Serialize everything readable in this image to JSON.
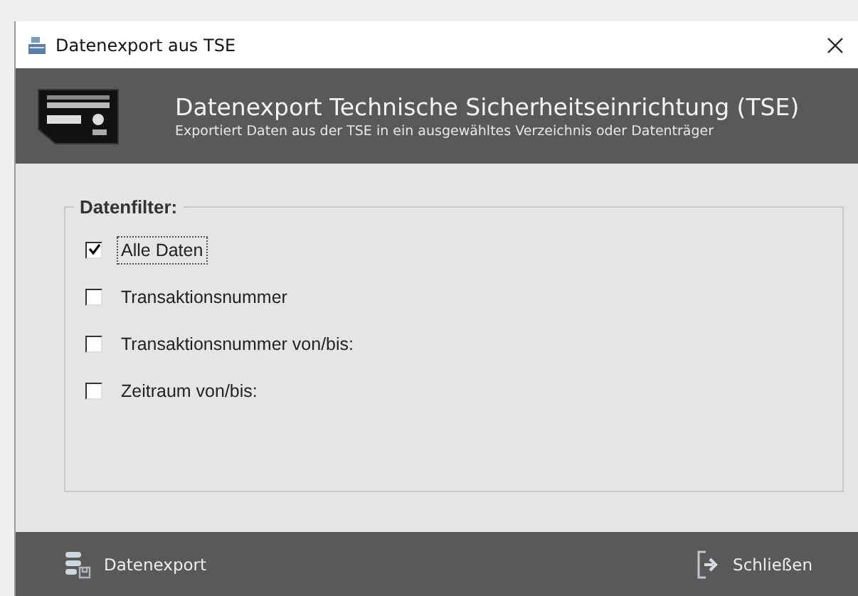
{
  "window": {
    "title": "Datenexport aus TSE"
  },
  "header": {
    "title": "Datenexport Technische Sicherheitseinrichtung (TSE)",
    "subtitle": "Exportiert Daten aus der TSE in ein ausgewähltes Verzeichnis oder Datenträger"
  },
  "filter": {
    "legend": "Datenfilter:",
    "options": [
      {
        "label": "Alle Daten",
        "checked": true,
        "focused": true
      },
      {
        "label": "Transaktionsnummer",
        "checked": false,
        "focused": false
      },
      {
        "label": "Transaktionsnummer von/bis:",
        "checked": false,
        "focused": false
      },
      {
        "label": "Zeitraum von/bis:",
        "checked": false,
        "focused": false
      }
    ]
  },
  "footer": {
    "export_label": "Datenexport",
    "close_label": "Schließen"
  }
}
